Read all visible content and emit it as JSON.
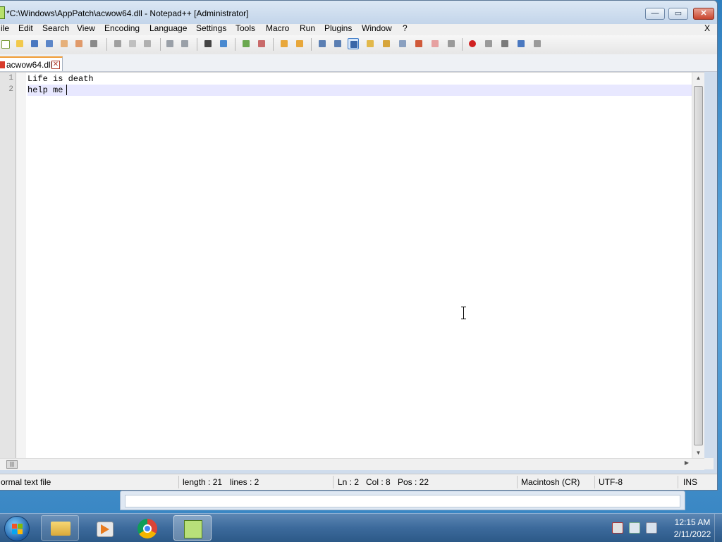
{
  "window": {
    "title": "*C:\\Windows\\AppPatch\\acwow64.dll - Notepad++ [Administrator]",
    "caption_buttons": {
      "minimize": "—",
      "maximize": "▭",
      "close": "✕"
    }
  },
  "menubar": {
    "items": [
      "ile",
      "Edit",
      "Search",
      "View",
      "Encoding",
      "Language",
      "Settings",
      "Tools",
      "Macro",
      "Run",
      "Plugins",
      "Window",
      "?"
    ],
    "close_label": "X"
  },
  "toolbar": {
    "icons": [
      "new-file-icon",
      "open-file-icon",
      "save-icon",
      "save-all-icon",
      "close-icon",
      "close-all-icon",
      "print-icon",
      "cut-icon",
      "copy-icon",
      "paste-icon",
      "undo-icon",
      "redo-icon",
      "find-icon",
      "replace-icon",
      "zoom-in-icon",
      "zoom-out-icon",
      "sync-vertical-icon",
      "sync-horizontal-icon",
      "word-wrap-icon",
      "show-all-characters-icon",
      "indent-guide-icon",
      "user-defined-language-icon",
      "document-map-icon",
      "function-list-icon",
      "folder-as-workspace-icon",
      "document-list-icon",
      "monitoring-icon",
      "record-macro-icon",
      "stop-recording-icon",
      "playback-macro-icon",
      "run-macro-multiple-icon",
      "save-macro-icon"
    ],
    "selected_icon": "indent-guide-icon"
  },
  "tab": {
    "label": "acwow64.dll",
    "close_glyph": "✕"
  },
  "editor": {
    "lines": [
      {
        "number": "1",
        "text": "Life is death"
      },
      {
        "number": "2",
        "text": "help me"
      }
    ],
    "current_line": 2
  },
  "scroll": {
    "hthumb_glyph": "|||",
    "vthumb_glyph": "≡"
  },
  "status": {
    "file_type": "ormal text file",
    "length": "length : 21",
    "lines": "lines : 2",
    "ln": "Ln : 2",
    "col": "Col : 8",
    "pos": "Pos : 22",
    "eol": "Macintosh (CR)",
    "encoding": "UTF-8",
    "mode": "INS"
  },
  "taskbar": {
    "apps": [
      "windows-explorer-icon",
      "media-player-icon",
      "chrome-icon",
      "notepad-plus-plus-icon"
    ],
    "active_app": "notepad-plus-plus-icon",
    "tray_icons": [
      "action-center-icon",
      "network-icon",
      "volume-icon"
    ],
    "clock": {
      "time": "12:15 AM",
      "date": "2/11/2022"
    }
  },
  "colors": {
    "current_line": "#e8e8ff",
    "tab_accent": "#f09b34",
    "taskbar": "#3c6a9c"
  }
}
